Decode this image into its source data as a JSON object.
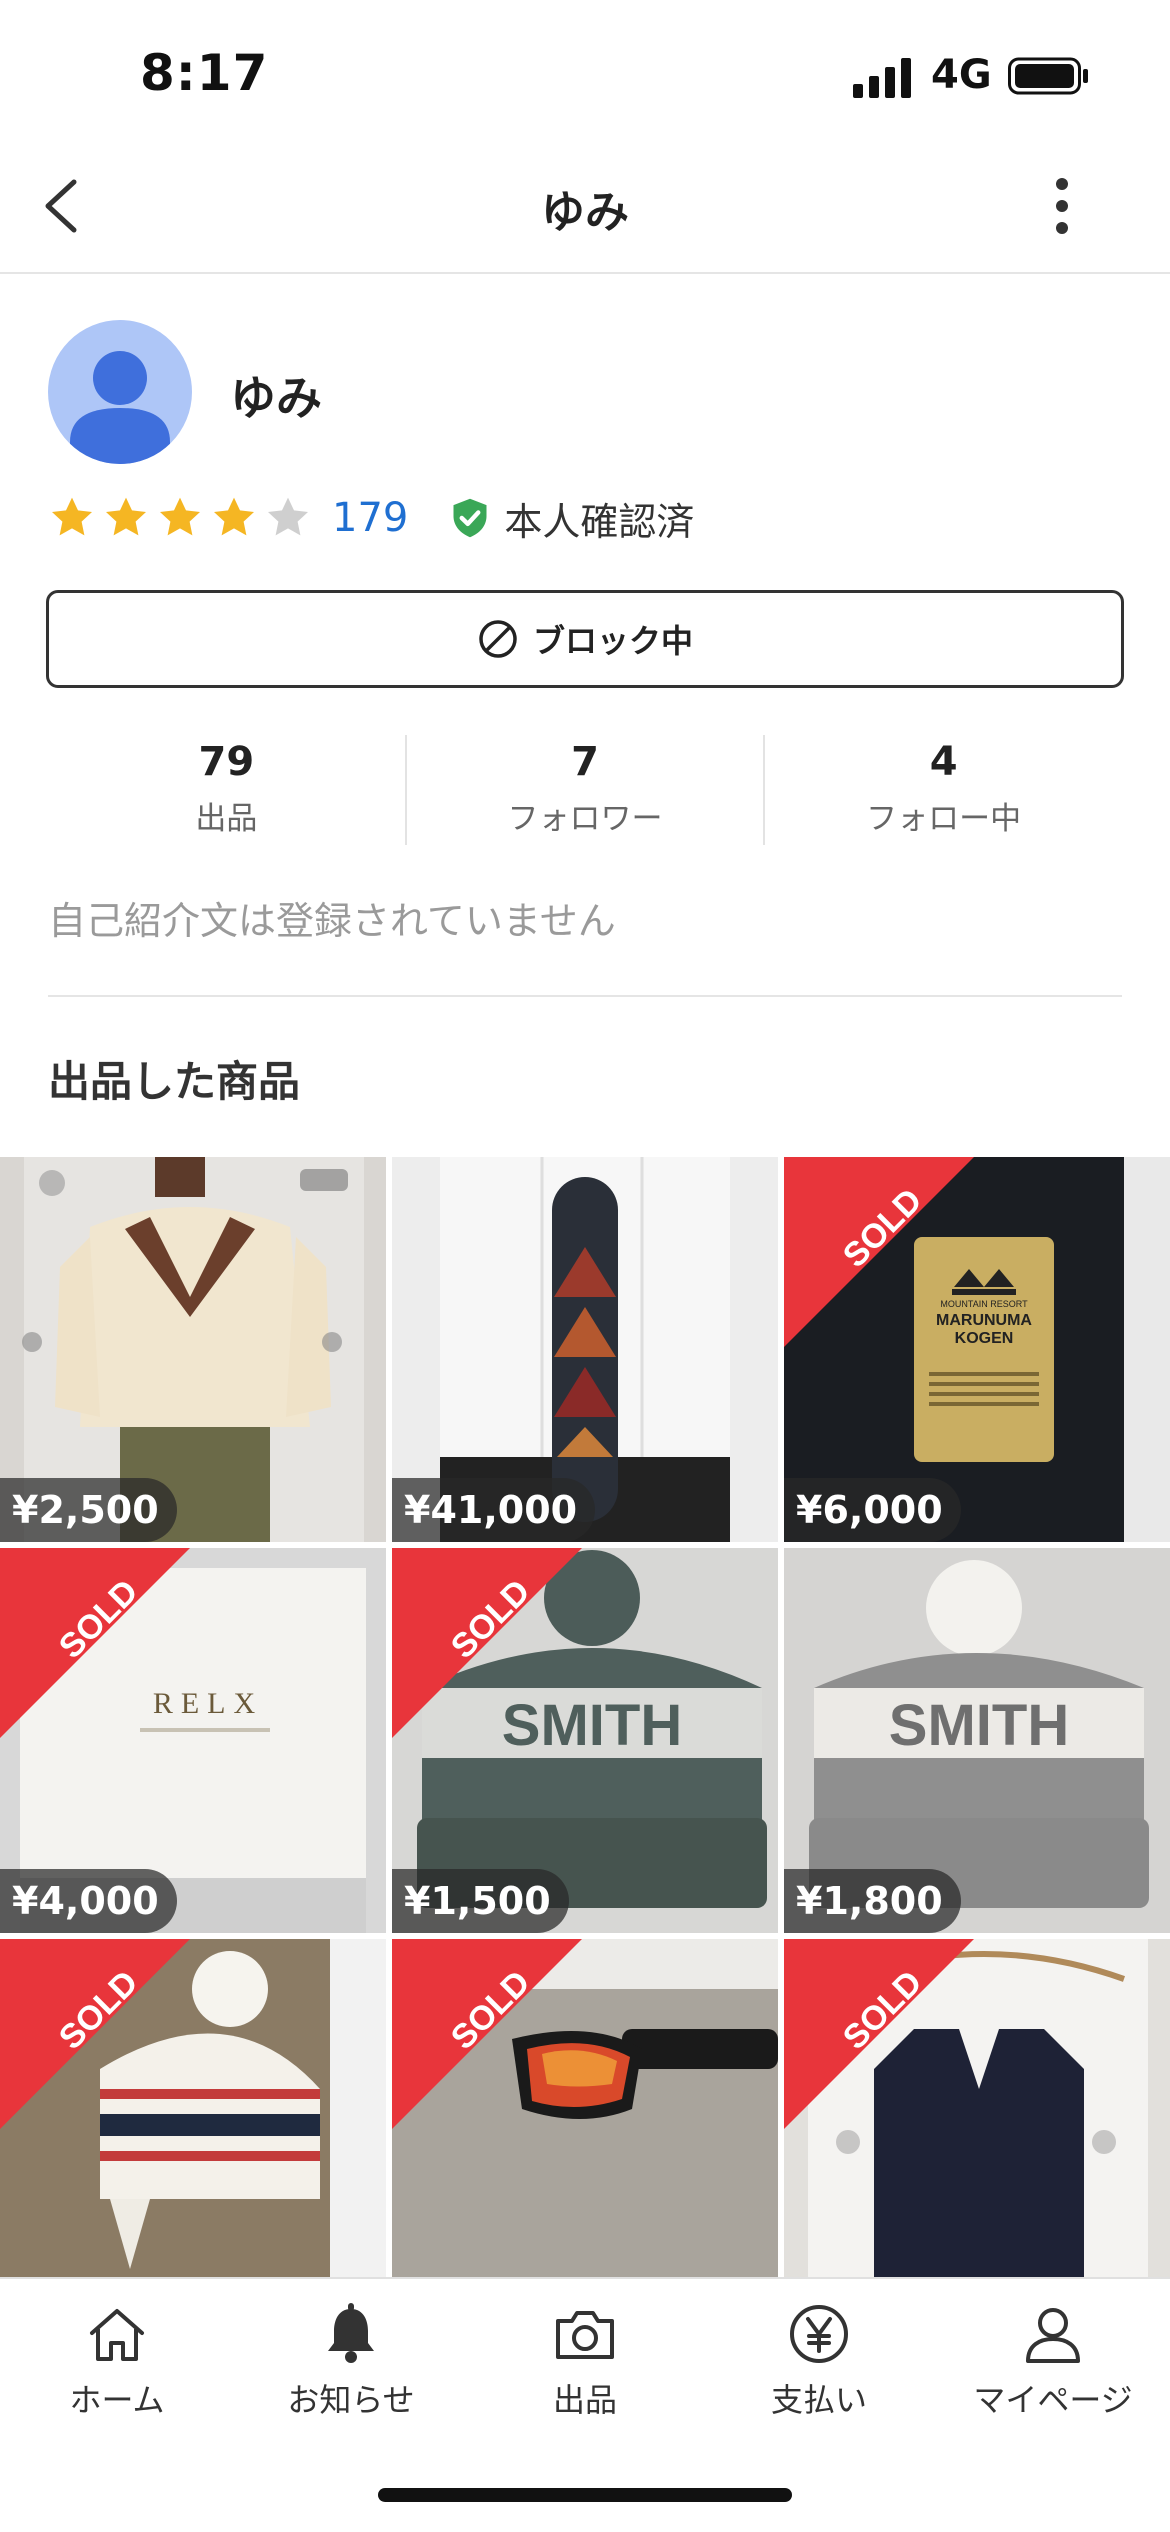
{
  "status_bar": {
    "time": "8:17",
    "network": "4G"
  },
  "nav": {
    "title": "ゆみ"
  },
  "profile": {
    "name": "ゆみ",
    "rating_stars": 4,
    "rating_max": 5,
    "review_count": "179",
    "verified_label": "本人確認済",
    "block_button_label": "ブロック中",
    "stats": [
      {
        "value": "79",
        "label": "出品"
      },
      {
        "value": "7",
        "label": "フォロワー"
      },
      {
        "value": "4",
        "label": "フォロー中"
      }
    ],
    "bio": "自己紹介文は登録されていません"
  },
  "items_section": {
    "title": "出品した商品",
    "sold_label": "SOLD",
    "items": [
      {
        "price": "¥2,500",
        "sold": false
      },
      {
        "price": "¥41,000",
        "sold": false
      },
      {
        "price": "¥6,000",
        "sold": true,
        "card_text": [
          "MOUNTAIN RESORT",
          "MARUNUMA",
          "KOGEN"
        ]
      },
      {
        "price": "¥4,000",
        "sold": true,
        "box_text": "RELX"
      },
      {
        "price": "¥1,500",
        "sold": true,
        "hat_text": "SMITH"
      },
      {
        "price": "¥1,800",
        "sold": false,
        "hat_text": "SMITH"
      },
      {
        "price": "",
        "sold": true
      },
      {
        "price": "",
        "sold": true
      },
      {
        "price": "",
        "sold": true
      }
    ]
  },
  "tab_bar": {
    "tabs": [
      {
        "label": "ホーム",
        "icon": "home-icon"
      },
      {
        "label": "お知らせ",
        "icon": "bell-icon"
      },
      {
        "label": "出品",
        "icon": "camera-icon"
      },
      {
        "label": "支払い",
        "icon": "yen-icon"
      },
      {
        "label": "マイページ",
        "icon": "person-icon"
      }
    ]
  },
  "colors": {
    "accent_blue": "#1f6fd1",
    "sold_red": "#e8353b",
    "star_yellow": "#f5b623",
    "verified_green": "#3aa757"
  }
}
